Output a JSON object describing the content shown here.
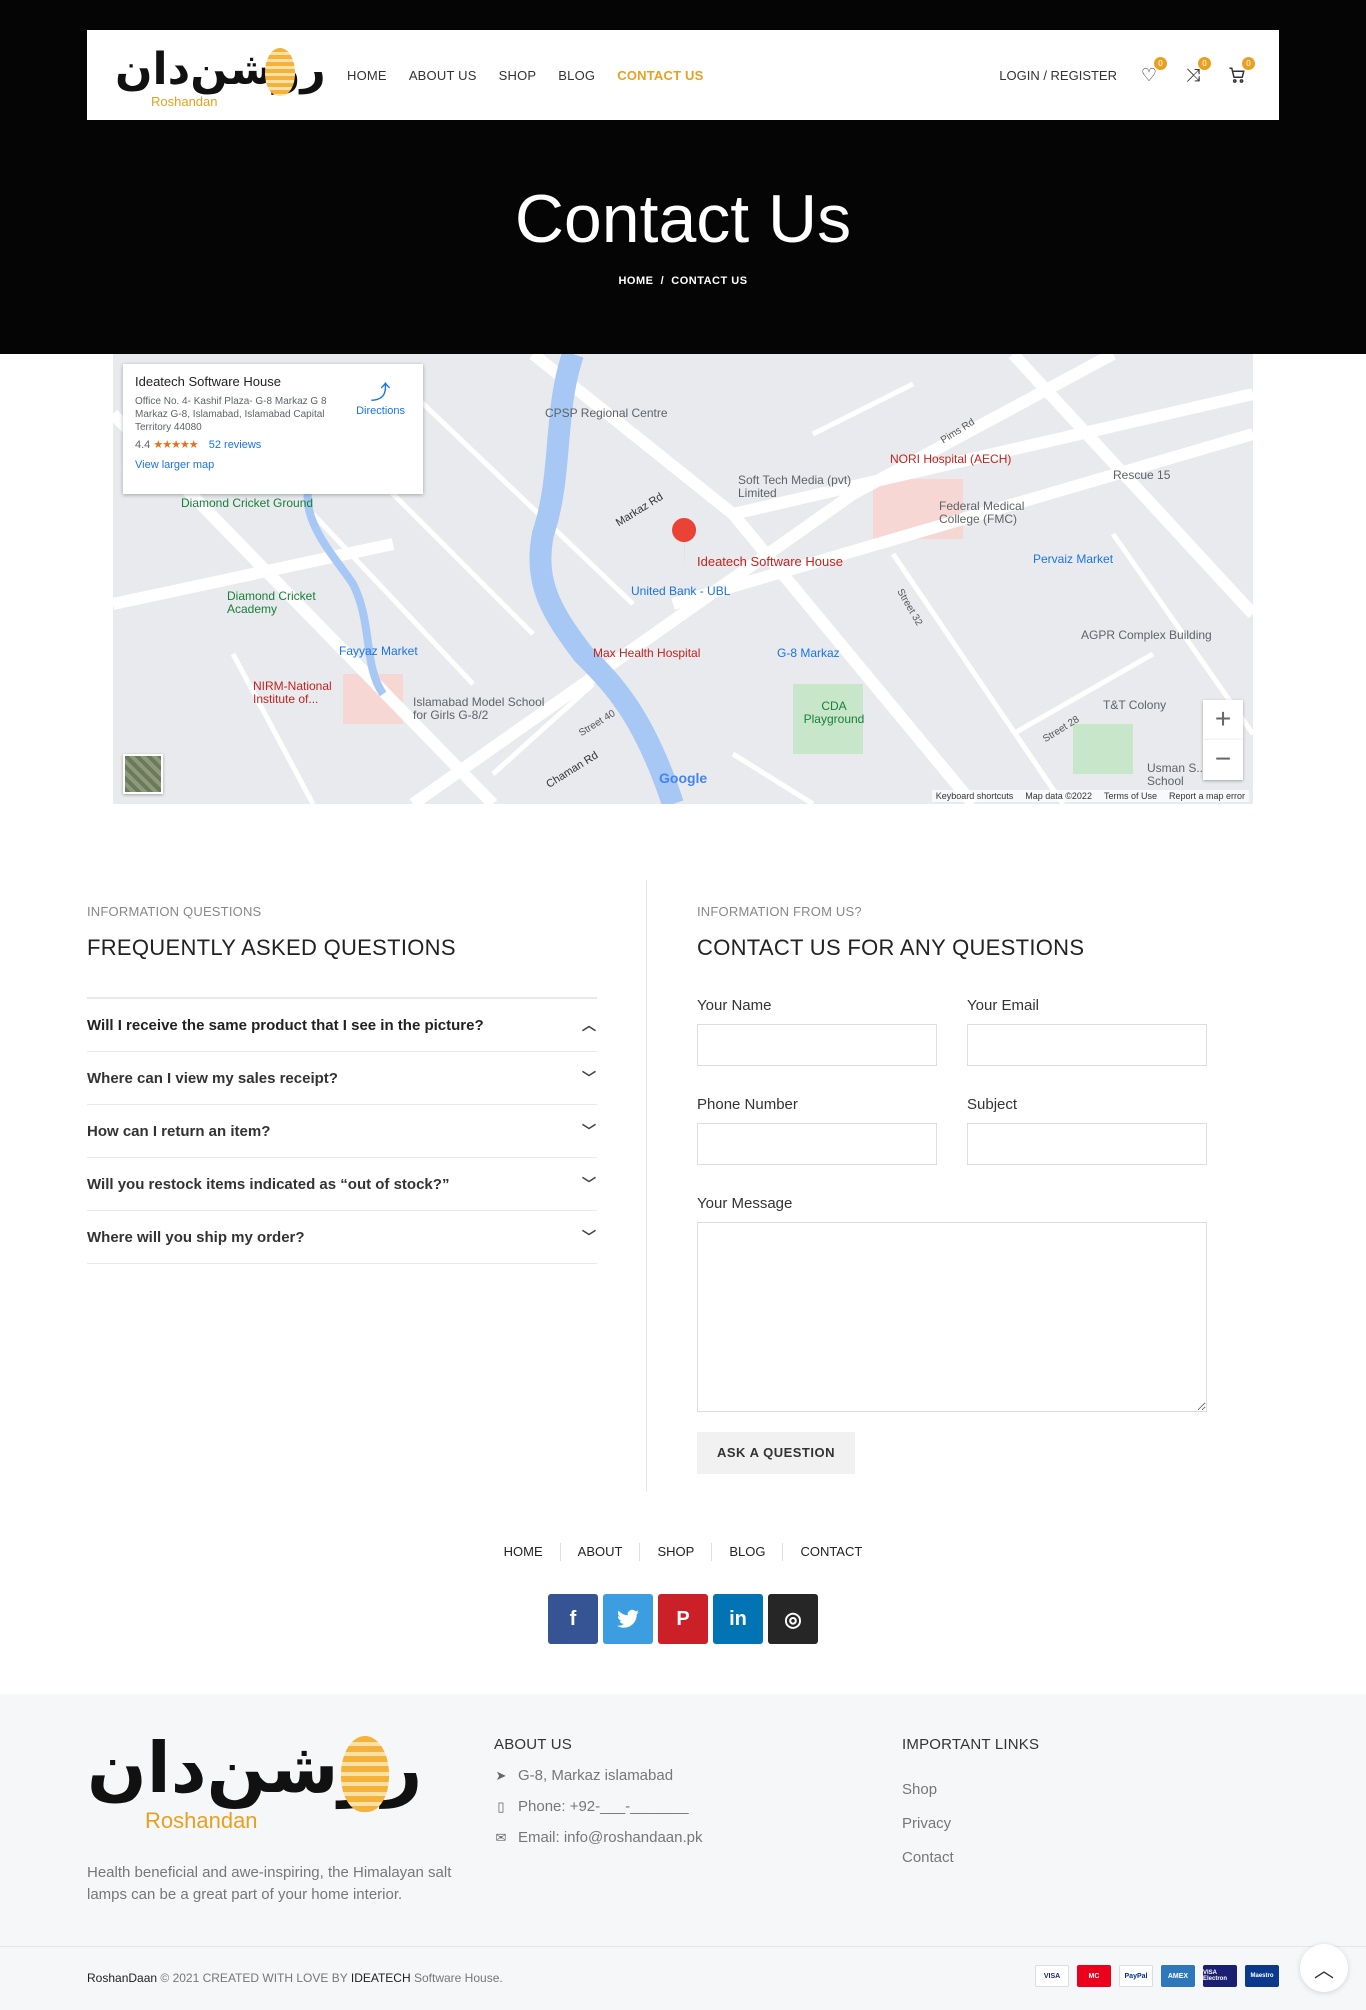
{
  "header": {
    "logo_ar": "روشن‌دان",
    "logo_en": "Roshandan",
    "nav": [
      "HOME",
      "ABOUT US",
      "SHOP",
      "BLOG",
      "CONTACT US"
    ],
    "active_nav": "CONTACT US",
    "login": "LOGIN / REGISTER",
    "wishlist_count": "0",
    "compare_count": "0",
    "cart_count": "0"
  },
  "hero": {
    "title": "Contact Us",
    "breadcrumb_home": "HOME",
    "breadcrumb_sep": "/",
    "breadcrumb_current": "CONTACT US"
  },
  "map": {
    "place_name": "Ideatech Software House",
    "address": "Office No. 4- Kashif Plaza- G-8 Markaz G 8 Markaz G-8, Islamabad, Islamabad Capital Territory 44080",
    "rating": "4.4",
    "stars": "★★★★★",
    "reviews": "52 reviews",
    "larger_map": "View larger map",
    "directions": "Directions",
    "labels": [
      "CPSP Regional Centre",
      "Soft Tech Media (pvt) Limited",
      "NORI Hospital (AECH)",
      "Federal Medical College (FMC)",
      "Rescue 15",
      "Pervaiz Market",
      "Ideatech Software House",
      "United Bank - UBL",
      "Max Health Hospital",
      "G-8 Markaz",
      "AGPR Complex Building",
      "Diamond Cricket Ground",
      "Diamond Cricket Academy",
      "Fayyaz Market",
      "NIRM-National Institute of...",
      "Islamabad Model School for Girls G-8/2",
      "CDA Playground",
      "T&T Colony",
      "Usman S... Model School",
      "Markaz Rd",
      "Chaman Rd",
      "Street 40",
      "Street 28",
      "Street 32",
      "Pims Rd"
    ],
    "footer": [
      "Keyboard shortcuts",
      "Map data ©2022",
      "Terms of Use",
      "Report a map error"
    ],
    "google": "Google",
    "zoom_in": "+",
    "zoom_out": "−"
  },
  "faq": {
    "eyebrow": "INFORMATION QUESTIONS",
    "title": "FREQUENTLY ASKED QUESTIONS",
    "items": [
      "Will I receive the same product that I see in the picture?",
      "Where can I view my sales receipt?",
      "How can I return an item?",
      "Will you restock items indicated as “out of stock?”",
      "Where will you ship my order?"
    ]
  },
  "contact": {
    "eyebrow": "INFORMATION FROM US?",
    "title": "CONTACT US FOR ANY QUESTIONS",
    "name_label": "Your Name",
    "email_label": "Your Email",
    "phone_label": "Phone Number",
    "subject_label": "Subject",
    "message_label": "Your Message",
    "button": "ASK A QUESTION"
  },
  "footer_nav": [
    "HOME",
    "ABOUT",
    "SHOP",
    "BLOG",
    "CONTACT"
  ],
  "social": [
    {
      "name": "facebook",
      "glyph": "f",
      "color": "#365493"
    },
    {
      "name": "twitter",
      "glyph": "t",
      "color": "#3CF0F0"
    },
    {
      "name": "pinterest",
      "glyph": "P",
      "color": "#CB2027"
    },
    {
      "name": "linkedin",
      "glyph": "in",
      "color": "#0274B3"
    },
    {
      "name": "instagram",
      "glyph": "◎",
      "color": "#262626"
    }
  ],
  "footer": {
    "desc": "Health beneficial and awe-inspiring, the Himalayan salt lamps can be a great part of your home interior.",
    "about_title": "ABOUT US",
    "address": "G-8, Markaz islamabad",
    "phone": "Phone: +92-___-_______",
    "email": "Email: info@roshandaan.pk",
    "links_title": "IMPORTANT LINKS",
    "links": [
      "Shop",
      "Privacy",
      "Contact"
    ],
    "copy_brand": "RoshanDaan",
    "copy_mid": " © 2021 CREATED WITH LOVE BY ",
    "copy_company": "IDEATECH",
    "copy_end": " Software House.",
    "payments": [
      "VISA",
      "MC",
      "PayPal",
      "AMEX",
      "VISA Electron",
      "Maestro"
    ]
  },
  "colors": {
    "accent": "#e8a020",
    "hero_bg": "#050505",
    "footer_bg": "#f5f7f9"
  }
}
